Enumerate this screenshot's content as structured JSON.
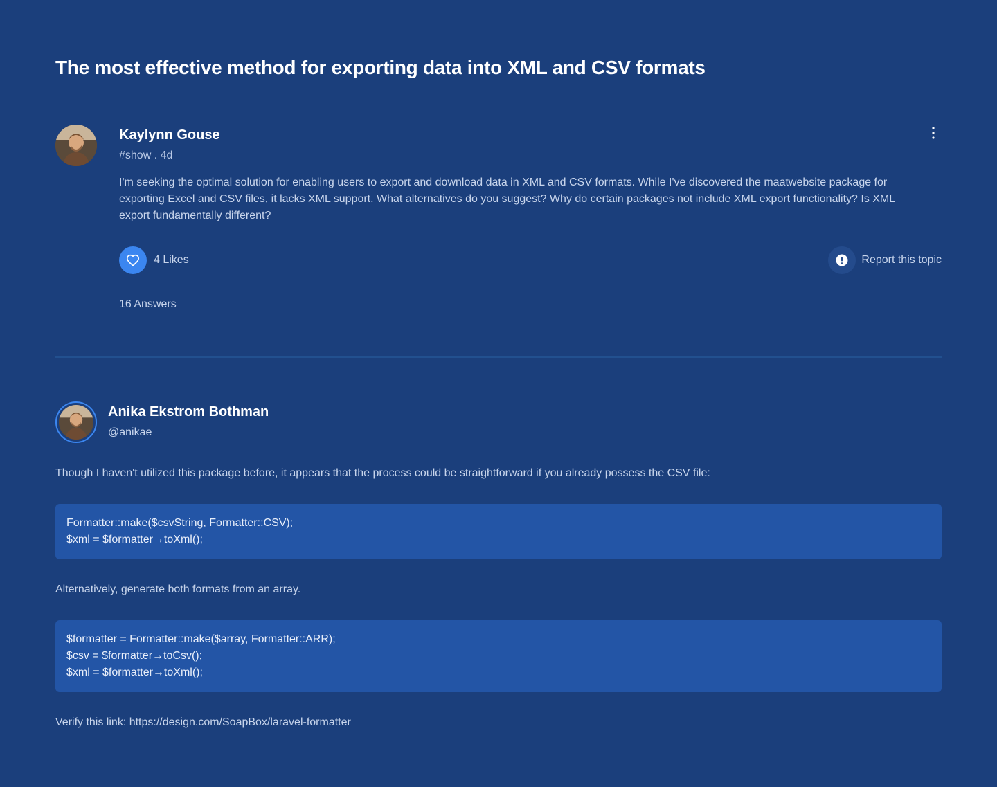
{
  "topic": {
    "title": "The most effective method for exporting data into XML and CSV formats"
  },
  "post": {
    "author": "Kaylynn Gouse",
    "meta": "#show . 4d",
    "body": "I'm seeking the optimal solution for enabling users to export and download data in XML and CSV formats. While I've discovered the maatwebsite package for exporting Excel and CSV files, it lacks XML support. What alternatives do you suggest? Why do certain packages not include XML export functionality? Is XML export fundamentally different?",
    "likes_label": "4 Likes",
    "report_label": "Report this topic",
    "answers_label": "16 Answers",
    "icons": {
      "more": "more-vertical-icon",
      "like": "heart-icon",
      "report": "alert-icon"
    }
  },
  "answer": {
    "author": "Anika Ekstrom Bothman",
    "handle": "@anikae",
    "intro": "Though I haven't utilized this package before, it appears that the process could be straightforward if you already possess the CSV file:",
    "code1": [
      "Formatter::make($csvString, Formatter::CSV);",
      "$xml = $formatter→toXml();"
    ],
    "middle": "Alternatively, generate both formats from an array.",
    "code2": [
      "$formatter = Formatter::make($array, Formatter::ARR);",
      "$csv = $formatter→toCsv();",
      "$xml = $formatter→toXml();"
    ],
    "footer": "Verify this link: https://design.com/SoapBox/laravel-formatter"
  },
  "colors": {
    "background": "#1b3f7c",
    "accent": "#3b86f0",
    "code_background": "#2355a6",
    "muted_text": "#c8d5ec"
  }
}
